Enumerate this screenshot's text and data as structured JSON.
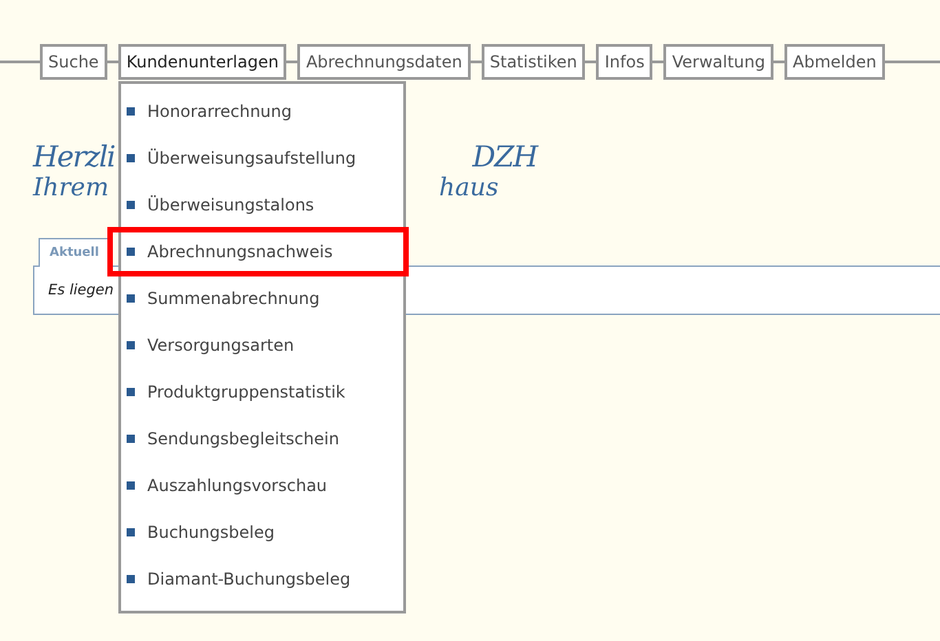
{
  "nav": [
    {
      "label": "Suche",
      "selected": false
    },
    {
      "label": "Kundenunterlagen",
      "selected": true
    },
    {
      "label": "Abrechnungsdaten",
      "selected": false
    },
    {
      "label": "Statistiken",
      "selected": false
    },
    {
      "label": "Infos",
      "selected": false
    },
    {
      "label": "Verwaltung",
      "selected": false
    },
    {
      "label": "Abmelden",
      "selected": false
    }
  ],
  "dropdown": {
    "items": [
      {
        "label": "Honorarrechnung",
        "highlighted": false
      },
      {
        "label": "Überweisungsaufstellung",
        "highlighted": false
      },
      {
        "label": "Überweisungstalons",
        "highlighted": false
      },
      {
        "label": "Abrechnungsnachweis",
        "highlighted": true
      },
      {
        "label": "Summenabrechnung",
        "highlighted": false
      },
      {
        "label": "Versorgungsarten",
        "highlighted": false
      },
      {
        "label": "Produktgruppenstatistik",
        "highlighted": false
      },
      {
        "label": "Sendungsbegleitschein",
        "highlighted": false
      },
      {
        "label": "Auszahlungsvorschau",
        "highlighted": false
      },
      {
        "label": "Buchungsbeleg",
        "highlighted": false
      },
      {
        "label": "Diamant-Buchungsbeleg",
        "highlighted": false
      }
    ]
  },
  "greeting": {
    "line_1": [
      "Herzli",
      "DZH"
    ],
    "line_2": [
      "Ihrem",
      "haus"
    ]
  },
  "tabs": [
    {
      "label": "Aktuell",
      "selected": true
    }
  ],
  "panel": {
    "text": "Es liegen"
  }
}
